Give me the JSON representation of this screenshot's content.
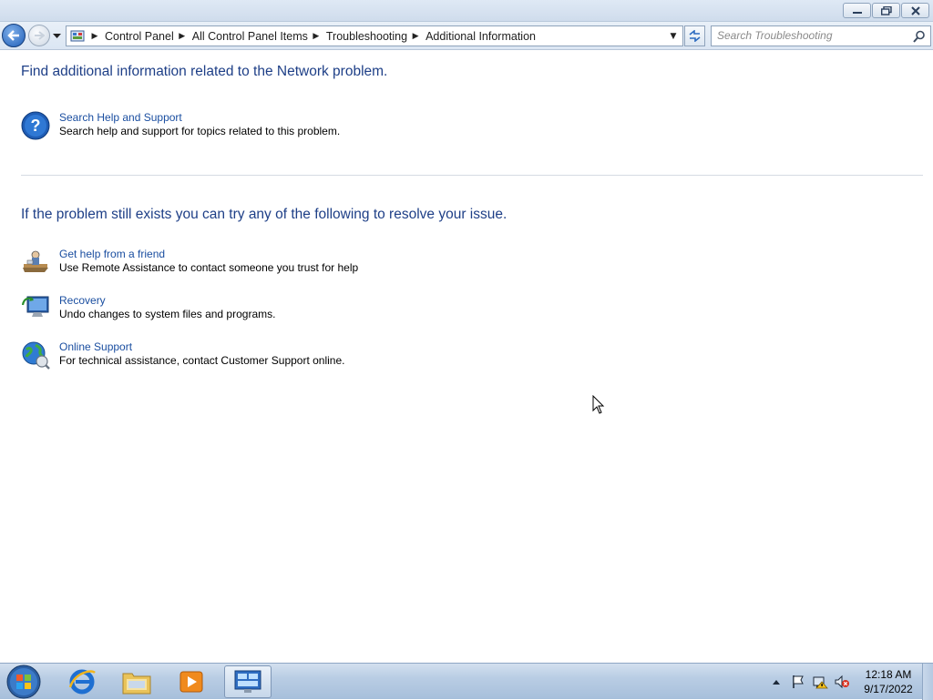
{
  "window": {
    "controls": {
      "minimize": "minimize",
      "maximize": "restore",
      "close": "close"
    }
  },
  "navigation": {
    "breadcrumbs": [
      "Control Panel",
      "All Control Panel Items",
      "Troubleshooting",
      "Additional Information"
    ],
    "search_placeholder": "Search Troubleshooting"
  },
  "content": {
    "heading_1": "Find additional information related to the Network problem.",
    "heading_2": "If the problem still exists you can try any of the following to resolve your issue.",
    "tasks": [
      {
        "icon": "help-question-icon",
        "title": "Search Help and Support",
        "description": "Search help and support for topics related to this problem."
      },
      {
        "icon": "remote-assistance-icon",
        "title": "Get help from a friend",
        "description": "Use Remote Assistance to contact someone you trust for help"
      },
      {
        "icon": "recovery-icon",
        "title": "Recovery",
        "description": "Undo changes to system files and programs."
      },
      {
        "icon": "online-support-globe-icon",
        "title": "Online Support",
        "description": "For technical assistance, contact Customer Support online."
      }
    ]
  },
  "taskbar": {
    "apps": [
      "internet-explorer-icon",
      "windows-explorer-icon",
      "media-player-icon",
      "control-panel-icon"
    ],
    "tray_icons": [
      "show-hidden-icons-icon",
      "action-center-flag-icon",
      "network-icon",
      "volume-muted-icon"
    ],
    "clock": {
      "time": "12:18 AM",
      "date": "9/17/2022"
    }
  },
  "colors": {
    "heading": "#1e3f87",
    "link": "#1a4ea0",
    "taskbar": "#b9cde4"
  }
}
